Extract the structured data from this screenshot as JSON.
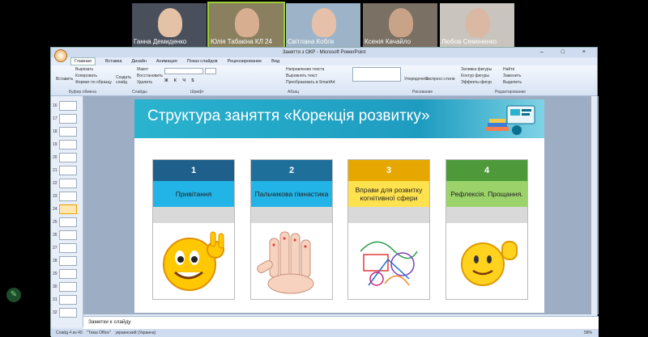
{
  "participants": [
    {
      "name": "Ганна Демиденко",
      "bg": "#4a4f5c",
      "skin": "#e3c2a5"
    },
    {
      "name": "Юлія Табакіна КЛ 24",
      "bg": "#8a8060",
      "skin": "#d8ae90",
      "active": true
    },
    {
      "name": "Світлана Кобгік",
      "bg": "#9db4c8",
      "skin": "#e6c0a8"
    },
    {
      "name": "Ксенія Качайло",
      "bg": "#7a7064",
      "skin": "#c9a388"
    },
    {
      "name": "Любов Семененко",
      "bg": "#c9c4bd",
      "skin": "#dab8a3"
    }
  ],
  "window": {
    "title": "Заняття з ОКР - Microsoft PowerPoint",
    "win_controls": "– □ ×"
  },
  "ribbon": {
    "tabs": [
      "Главная",
      "Вставка",
      "Дизайн",
      "Анимация",
      "Показ слайдов",
      "Рецензирование",
      "Вид"
    ],
    "clipboard": {
      "paste": "Вставить",
      "cut": "Вырезать",
      "copy": "Копировать",
      "format": "Формат по образцу",
      "label": "Буфер обмена"
    },
    "slides": {
      "new": "Создать слайд",
      "layout": "Макет",
      "reset": "Восстановить",
      "delete": "Удалить",
      "label": "Слайды"
    },
    "font_label": "Шрифт",
    "paragraph": {
      "direction": "Направление текста",
      "align": "Выровнять текст",
      "smartart": "Преобразовать в SmartArt",
      "label": "Абзац"
    },
    "drawing": {
      "arrange": "Упорядочить",
      "styles": "Экспресс-стили",
      "fill": "Заливка фигуры",
      "outline": "Контур фигуры",
      "effects": "Эффекты фигур",
      "label": "Рисование"
    },
    "editing": {
      "find": "Найти",
      "replace": "Заменить",
      "select": "Выделить",
      "label": "Редактирование"
    }
  },
  "slide": {
    "title": "Структура заняття «Корекція розвитку»",
    "cards": [
      {
        "number": "1",
        "label": "Привітання",
        "top_color": "#1f5f8b",
        "mid_color": "#22b4e6",
        "icon": "emoji-ok-hand-icon"
      },
      {
        "number": "2",
        "label": "Пальчикова гімнастика",
        "top_color": "#1f6f9b",
        "mid_color": "#22b4e6",
        "icon": "finger-faces-icon"
      },
      {
        "number": "3",
        "label": "Вправи для розвитку когнітивної сфери",
        "top_color": "#e6a800",
        "mid_color": "#ffe24d",
        "icon": "overlapping-drawings-icon"
      },
      {
        "number": "4",
        "label": "Рефлексія. Прощання.",
        "top_color": "#4e9a3a",
        "mid_color": "#9bd36a",
        "icon": "emoji-wave-icon"
      }
    ]
  },
  "notes_placeholder": "Заметки к слайду",
  "status": {
    "slide": "Слайд 4 из 40",
    "theme": "\"Тема Office\"",
    "lang": "украинский (Украина)",
    "zoom": "58%"
  }
}
